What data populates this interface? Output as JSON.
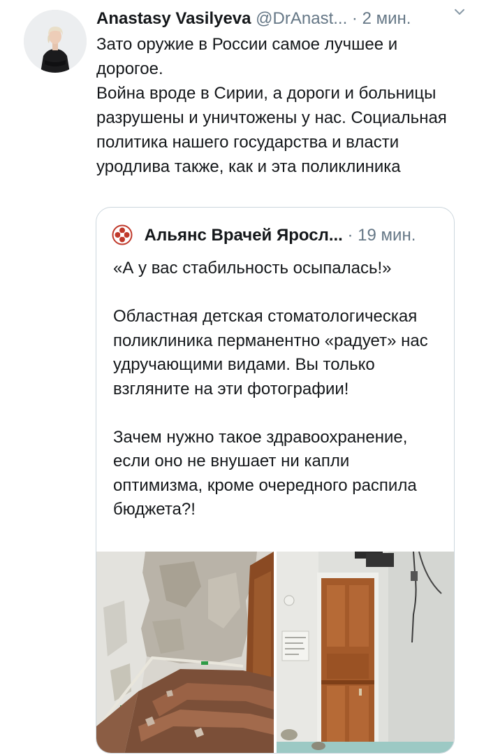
{
  "tweet": {
    "author_name": "Anastasy Vasilyeva",
    "author_handle": "@DrAnast...",
    "separator": "·",
    "time": "2 мин.",
    "text": "Зато оружие в России самое лучшее и дорогое.\nВойна вроде в Сирии, а дороги и больницы разрушены и уничтожены у нас. Социальная политика нашего государства и власти уродлива также, как и эта поликлиника",
    "caret_icon": "chevron-down-icon"
  },
  "quoted_tweet": {
    "author_name": "Альянс Врачей Яросл...",
    "separator": "·",
    "time": "19 мин.",
    "avatar_icon": "medical-cross-logo",
    "text": "«А у вас стабильность осыпалась!»\n\nОбластная детская стоматологическая поликлиника перманентно «радует» нас удручающими видами. Вы только взгляните на эти фотографии!\n\nЗачем нужно такое здравоохранение, если оно не внушает ни капли оптимизма, кроме очередного распила бюджета?!",
    "media": [
      {
        "subject": "peeling-wall-and-stairs-photo"
      },
      {
        "subject": "wooden-door-photo"
      }
    ]
  },
  "colors": {
    "text_primary": "#14171a",
    "text_secondary": "#657786",
    "border": "#ccd6dd",
    "quote_logo_red": "#c0392b"
  }
}
